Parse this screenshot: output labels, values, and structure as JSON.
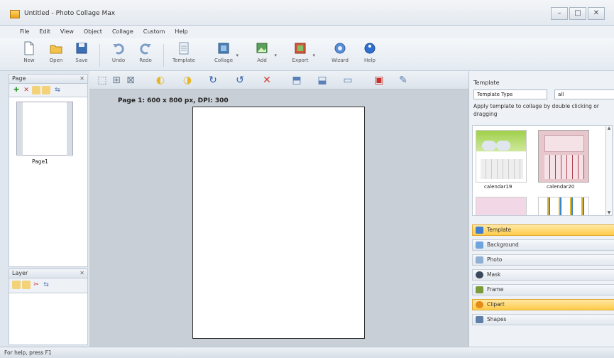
{
  "window": {
    "title": "Untitled - Photo Collage Max",
    "minimize": "–",
    "maximize": "□",
    "close": "✕"
  },
  "menu": [
    "File",
    "Edit",
    "View",
    "Object",
    "Collage",
    "Custom",
    "Help"
  ],
  "toolbar": {
    "new": "New",
    "open": "Open",
    "save": "Save",
    "undo": "Undo",
    "redo": "Redo",
    "template": "Template",
    "collage": "Collage",
    "add": "Add",
    "export": "Export",
    "wizard": "Wizard",
    "help": "Help"
  },
  "page_panel": {
    "title": "Page",
    "page_label": "Page1"
  },
  "layer_panel": {
    "title": "Layer"
  },
  "canvas": {
    "page_info": "Page 1: 600 x 800 px, DPI: 300"
  },
  "template_panel": {
    "title": "Template",
    "tab_label": "Template Type",
    "select_value": "all",
    "description": "Apply template to collage by double clicking or dragging",
    "thumbs": [
      {
        "label": "calendar19"
      },
      {
        "label": "calendar20"
      }
    ]
  },
  "sections": [
    {
      "label": "Template",
      "active": true
    },
    {
      "label": "Background",
      "active": false
    },
    {
      "label": "Photo",
      "active": false
    },
    {
      "label": "Mask",
      "active": false
    },
    {
      "label": "Frame",
      "active": false
    },
    {
      "label": "Clipart",
      "active": true
    },
    {
      "label": "Shapes",
      "active": false
    }
  ],
  "status": {
    "text": "For help, press F1"
  },
  "colors": {
    "accent": "#ffcc4a",
    "toolbar_bg": "#e4eaf1",
    "canvas_bg": "#c9cfd6"
  }
}
